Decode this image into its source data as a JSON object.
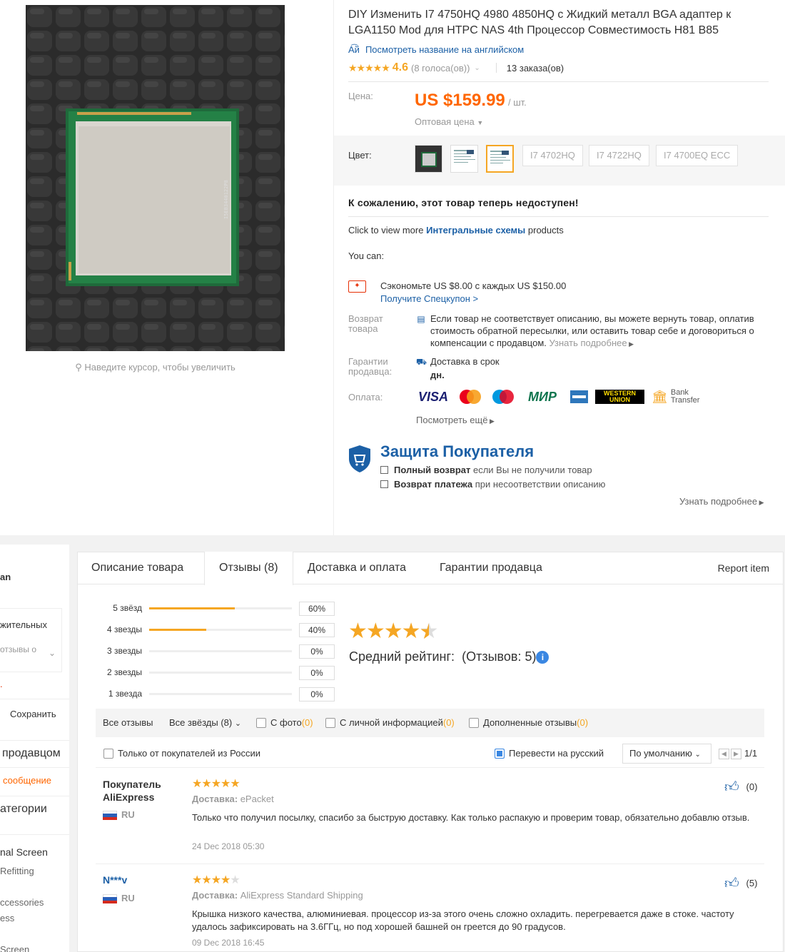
{
  "product": {
    "title": "DIY Изменить I7 4750HQ 4980 4850HQ с Жидкий металл BGA адаптер к LGA1150 Mod для HTPC NAS 4th Процессор Совместимость H81 B85",
    "translate_link": "Посмотреть название на английском",
    "rating": "4.6",
    "votes": "(8 голоса(ов))",
    "orders": "13 заказа(ов)",
    "zoom_hint": "Наведите курсор, чтобы увеличить",
    "price_label": "Цена:",
    "price": "US $159.99",
    "per_unit": "/ шт.",
    "wholesale": "Оптовая цена",
    "color_label": "Цвет:",
    "color_options": [
      "I7 4702HQ",
      "I7 4722HQ",
      "I7 4700EQ ECC"
    ],
    "unavailable": "К сожалению, этот товар теперь недоступен!",
    "more_prefix": "Click to view more",
    "more_category": "Интегральные схемы",
    "more_suffix": "products",
    "you_can": "You can:",
    "coupon_text": "Сэкономьте US $8.00 с каждых US $150.00",
    "coupon_link": "Получите Спецкупон >",
    "return_label": "Возврат товара",
    "return_text": "Если товар не соответствует описанию, вы можете вернуть товар, оплатив стоимость обратной пересылки, или оставить товар себе и договориться о компенсации с продавцом.",
    "return_link": "Узнать подробнее",
    "guarantee_label": "Гарантии продавца:",
    "delivery_text": "Доставка в срок",
    "delivery_days": "дн.",
    "payment_label": "Оплата:",
    "payments": [
      "VISA",
      "MasterCard",
      "Maestro",
      "МИР",
      "American Express",
      "WESTERN UNION",
      "Bank Transfer"
    ],
    "see_more": "Посмотреть ещё",
    "protection_title": "Защита Покупателя",
    "protection_1_bold": "Полный возврат",
    "protection_1_rest": "если Вы не получили товар",
    "protection_2_bold": "Возврат платежа",
    "protection_2_rest": "при несоответствии описанию",
    "learn_more": "Узнать подробнее"
  },
  "sidebar": {
    "frag_1": "an",
    "frag_2": "жительных",
    "frag_3": "отзывы о",
    "frag_4": ".",
    "save": "Сохранить",
    "contact_seller": "продавцом",
    "message": "сообщение",
    "categories": "атегории",
    "cat_items": [
      "nal Screen",
      "Refitting",
      "ccessories",
      "ess",
      "Screen"
    ]
  },
  "tabs": {
    "items": [
      "Описание товара",
      "Отзывы (8)",
      "Доставка и оплата",
      "Гарантии продавца"
    ],
    "report": "Report item"
  },
  "reviews": {
    "distribution": [
      {
        "label": "5 звёзд",
        "pct": "60%",
        "value": 0.6
      },
      {
        "label": "4 звезды",
        "pct": "40%",
        "value": 0.4
      },
      {
        "label": "3 звезды",
        "pct": "0%",
        "value": 0
      },
      {
        "label": "2 звезды",
        "pct": "0%",
        "value": 0
      },
      {
        "label": "1 звезда",
        "pct": "0%",
        "value": 0
      }
    ],
    "avg_label": "Средний рейтинг:",
    "avg_count": "(Отзывов: 5)",
    "filters": {
      "all": "Все отзывы",
      "all_stars": "Все звёзды (8)",
      "with_photo": "С фото",
      "with_photo_count": "(0)",
      "with_info": "С личной информацией",
      "with_info_count": "(0)",
      "additional": "Дополненные отзывы",
      "additional_count": "(0)",
      "russia_only": "Только от покупателей из России",
      "translate": "Перевести на русский",
      "sort": "По умолчанию",
      "page": "1/1"
    },
    "items": [
      {
        "name": "Покупатель AliExpress",
        "country": "RU",
        "stars": 5,
        "delivery_label": "Доставка:",
        "delivery": "ePacket",
        "text": "Только что получил посылку, спасибо за быструю доставку. Как только распакую и проверим товар, обязательно добавлю отзыв.",
        "date": "24 Dec 2018 05:30",
        "likes": "(0)"
      },
      {
        "name": "N***v",
        "country": "RU",
        "stars": 4,
        "delivery_label": "Доставка:",
        "delivery": "AliExpress Standard Shipping",
        "text": "Крышка низкого качества, алюминиевая. процессор из-за этого очень сложно охладить. перегревается даже в стоке. частоту удалось зафиксировать на 3.6ГГц, но под хорошей башней он греется до 90 градусов.",
        "date": "09 Dec 2018 16:45",
        "likes": "(5)"
      }
    ]
  },
  "colors": {
    "accent": "#f60",
    "star": "#f5a623",
    "link": "#1c60a6"
  }
}
